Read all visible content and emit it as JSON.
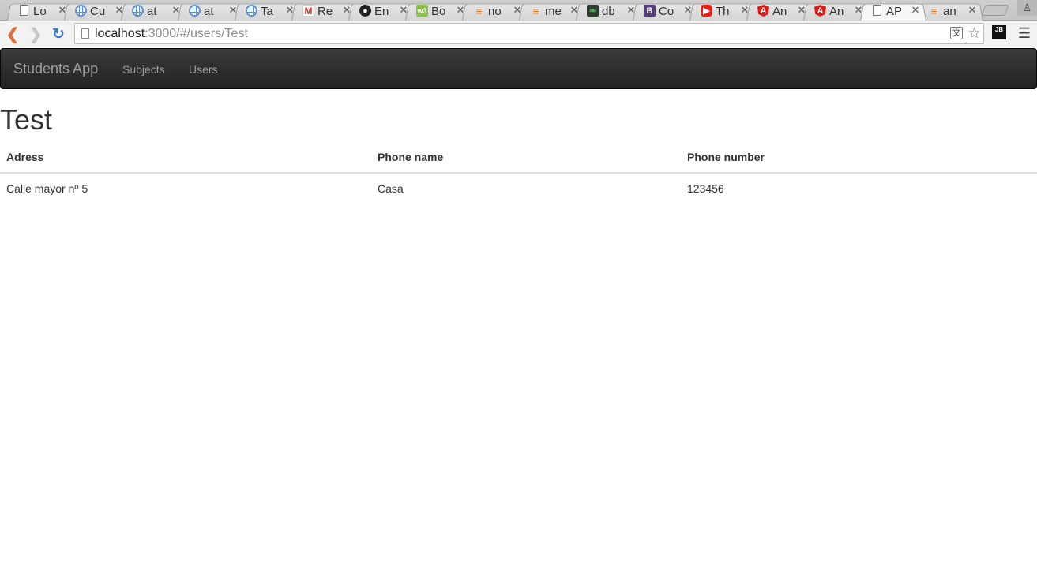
{
  "browser": {
    "tabs": [
      {
        "title": "Lo",
        "icon": "document-icon",
        "kind": "doc"
      },
      {
        "title": "Cu",
        "icon": "globe-grid-icon",
        "kind": "globe"
      },
      {
        "title": "at",
        "icon": "globe-icon",
        "kind": "globe"
      },
      {
        "title": "at",
        "icon": "globe-icon",
        "kind": "globe"
      },
      {
        "title": "Ta",
        "icon": "globe-grid-icon",
        "kind": "globe"
      },
      {
        "title": "Re",
        "icon": "gmail-icon",
        "kind": "gmail"
      },
      {
        "title": "En",
        "icon": "github-icon",
        "kind": "github"
      },
      {
        "title": "Bo",
        "icon": "w3schools-icon",
        "kind": "w3"
      },
      {
        "title": "no",
        "icon": "stackoverflow-icon",
        "kind": "so"
      },
      {
        "title": "me",
        "icon": "stackoverflow-icon",
        "kind": "so"
      },
      {
        "title": "db",
        "icon": "mongodb-icon",
        "kind": "mongo"
      },
      {
        "title": "Co",
        "icon": "bootstrap-icon",
        "kind": "bs"
      },
      {
        "title": "Th",
        "icon": "youtube-icon",
        "kind": "yt"
      },
      {
        "title": "An",
        "icon": "angular-icon",
        "kind": "ng"
      },
      {
        "title": "An",
        "icon": "angular-icon",
        "kind": "ng"
      },
      {
        "title": "AP",
        "icon": "document-icon",
        "kind": "doc",
        "active": true
      },
      {
        "title": "an",
        "icon": "stackoverflow-icon",
        "kind": "so"
      }
    ],
    "url_host": "localhost",
    "url_rest": ":3000/#/users/Test",
    "ext_label": "JB"
  },
  "navbar": {
    "brand": "Students App",
    "links": [
      "Subjects",
      "Users"
    ]
  },
  "page": {
    "title": "Test"
  },
  "table": {
    "headers": [
      "Adress",
      "Phone name",
      "Phone number"
    ],
    "rows": [
      [
        "Calle mayor nº 5",
        "Casa",
        "123456"
      ]
    ]
  }
}
